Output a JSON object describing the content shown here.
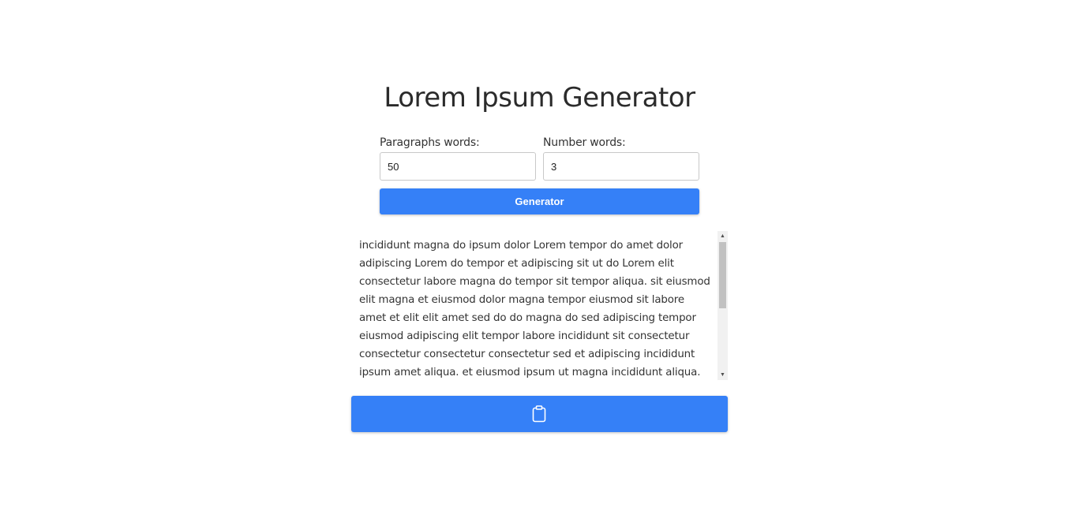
{
  "header": {
    "title": "Lorem Ipsum Generator"
  },
  "form": {
    "paragraphs": {
      "label": "Paragraphs words:",
      "value": "50"
    },
    "number": {
      "label": "Number words:",
      "value": "3"
    },
    "generate_label": "Generator"
  },
  "output": {
    "text": "incididunt magna do ipsum dolor Lorem tempor do amet dolor adipiscing Lorem do tempor et adipiscing sit ut do Lorem elit consectetur labore magna do tempor sit tempor aliqua. sit eiusmod elit magna et eiusmod dolor magna tempor eiusmod sit labore amet et elit elit amet sed do do magna do sed adipiscing tempor eiusmod adipiscing elit tempor labore incididunt sit consectetur consectetur consectetur consectetur sed et adipiscing incididunt ipsum amet aliqua. et eiusmod ipsum ut magna incididunt aliqua. do amet dolor sit"
  },
  "copy_button": {
    "icon": "clipboard-icon"
  },
  "colors": {
    "accent": "#3580f7",
    "text": "#333333",
    "background": "#ffffff"
  }
}
